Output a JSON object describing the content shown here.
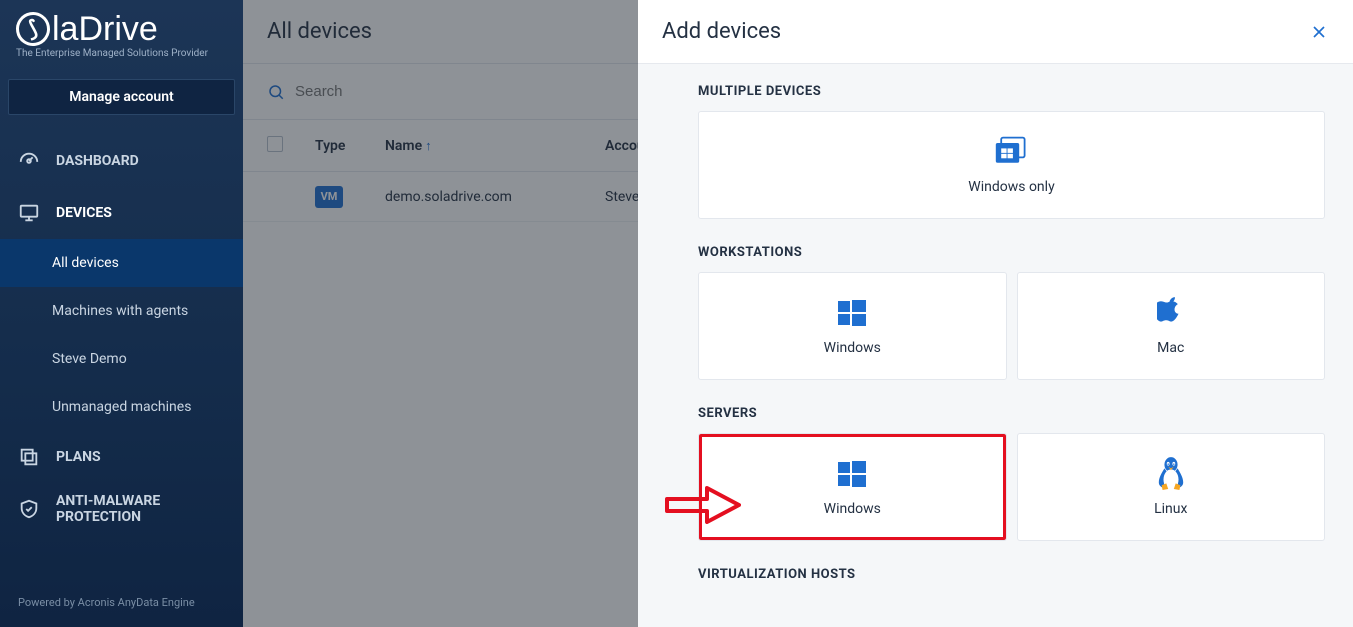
{
  "brand": {
    "name1": "S",
    "name2": "laDrive",
    "tagline": "The Enterprise Managed Solutions Provider"
  },
  "sidebar": {
    "manage_label": "Manage account",
    "items": {
      "dashboard": "DASHBOARD",
      "devices": "DEVICES",
      "plans": "PLANS",
      "antimalware_l1": "ANTI-MALWARE",
      "antimalware_l2": "PROTECTION"
    },
    "subitems": {
      "all": "All devices",
      "with_agents": "Machines with agents",
      "steve": "Steve Demo",
      "unmanaged": "Unmanaged machines"
    },
    "poweredby": "Powered by Acronis AnyData Engine"
  },
  "main": {
    "title": "All devices",
    "search_placeholder": "Search",
    "columns": {
      "type": "Type",
      "name": "Name",
      "account": "Account"
    },
    "row": {
      "type": "VM",
      "name": "demo.soladrive.com",
      "account": "Steve"
    }
  },
  "panel": {
    "title": "Add devices",
    "sections": {
      "multiple": "MULTIPLE DEVICES",
      "workstations": "WORKSTATIONS",
      "servers": "SERVERS",
      "virtualization": "VIRTUALIZATION HOSTS"
    },
    "cards": {
      "windows_only": "Windows only",
      "windows": "Windows",
      "mac": "Mac",
      "server_windows": "Windows",
      "server_linux": "Linux"
    }
  }
}
